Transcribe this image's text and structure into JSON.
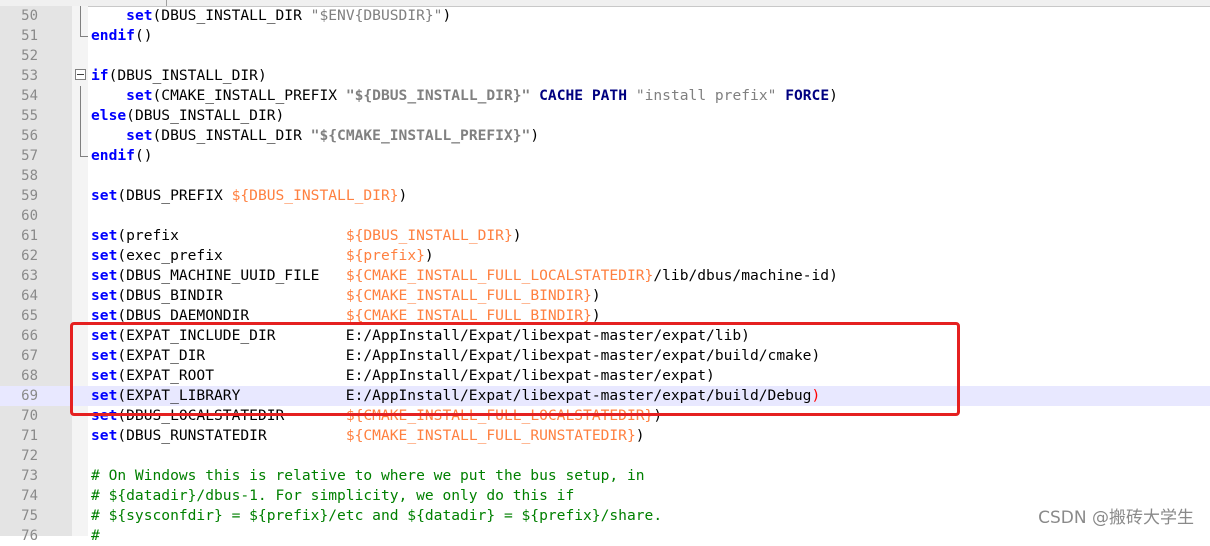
{
  "editor": {
    "lines": [
      {
        "n": "50",
        "fold": "vline",
        "indent": "    ",
        "parts": [
          [
            "kw",
            "set"
          ],
          [
            "",
            "(DBUS_INSTALL_DIR "
          ],
          [
            "str",
            "\"$ENV{DBUSDIR}\""
          ],
          [
            "",
            ")"
          ]
        ]
      },
      {
        "n": "51",
        "fold": "end",
        "indent": "",
        "parts": [
          [
            "kw",
            "endif"
          ],
          [
            "",
            "()"
          ]
        ]
      },
      {
        "n": "52",
        "fold": "",
        "indent": "",
        "parts": []
      },
      {
        "n": "53",
        "fold": "box",
        "indent": "",
        "parts": [
          [
            "kw",
            "if"
          ],
          [
            "",
            "(DBUS_INSTALL_DIR)"
          ]
        ]
      },
      {
        "n": "54",
        "fold": "vline",
        "indent": "    ",
        "parts": [
          [
            "kw",
            "set"
          ],
          [
            "",
            "(CMAKE_INSTALL_PREFIX "
          ],
          [
            "strv",
            "\"${DBUS_INSTALL_DIR}\""
          ],
          [
            "",
            " "
          ],
          [
            "kw2",
            "CACHE"
          ],
          [
            "",
            " "
          ],
          [
            "kw2",
            "PATH"
          ],
          [
            "",
            " "
          ],
          [
            "str",
            "\"install prefix\""
          ],
          [
            "",
            " "
          ],
          [
            "kw2",
            "FORCE"
          ],
          [
            "",
            ")"
          ]
        ]
      },
      {
        "n": "55",
        "fold": "vline",
        "indent": "",
        "parts": [
          [
            "kw",
            "else"
          ],
          [
            "",
            "(DBUS_INSTALL_DIR)"
          ]
        ]
      },
      {
        "n": "56",
        "fold": "vline",
        "indent": "    ",
        "parts": [
          [
            "kw",
            "set"
          ],
          [
            "",
            "(DBUS_INSTALL_DIR "
          ],
          [
            "strv",
            "\"${CMAKE_INSTALL_PREFIX}\""
          ],
          [
            "",
            ")"
          ]
        ]
      },
      {
        "n": "57",
        "fold": "end",
        "indent": "",
        "parts": [
          [
            "kw",
            "endif"
          ],
          [
            "",
            "()"
          ]
        ]
      },
      {
        "n": "58",
        "fold": "",
        "indent": "",
        "parts": []
      },
      {
        "n": "59",
        "fold": "",
        "indent": "",
        "parts": [
          [
            "kw",
            "set"
          ],
          [
            "",
            "(DBUS_PREFIX "
          ],
          [
            "var",
            "${DBUS_INSTALL_DIR}"
          ],
          [
            "",
            ")"
          ]
        ]
      },
      {
        "n": "60",
        "fold": "",
        "indent": "",
        "parts": []
      },
      {
        "n": "61",
        "fold": "",
        "indent": "",
        "parts": [
          [
            "kw",
            "set"
          ],
          [
            "",
            "(prefix                   "
          ],
          [
            "var",
            "${DBUS_INSTALL_DIR}"
          ],
          [
            "",
            ")"
          ]
        ]
      },
      {
        "n": "62",
        "fold": "",
        "indent": "",
        "parts": [
          [
            "kw",
            "set"
          ],
          [
            "",
            "(exec_prefix              "
          ],
          [
            "var",
            "${prefix}"
          ],
          [
            "",
            ")"
          ]
        ]
      },
      {
        "n": "63",
        "fold": "",
        "indent": "",
        "parts": [
          [
            "kw",
            "set"
          ],
          [
            "",
            "(DBUS_MACHINE_UUID_FILE   "
          ],
          [
            "var",
            "${CMAKE_INSTALL_FULL_LOCALSTATEDIR}"
          ],
          [
            "",
            "/lib/dbus/machine-id)"
          ]
        ]
      },
      {
        "n": "64",
        "fold": "",
        "indent": "",
        "parts": [
          [
            "kw",
            "set"
          ],
          [
            "",
            "(DBUS_BINDIR              "
          ],
          [
            "var",
            "${CMAKE_INSTALL_FULL_BINDIR}"
          ],
          [
            "",
            ")"
          ]
        ]
      },
      {
        "n": "65",
        "fold": "",
        "indent": "",
        "parts": [
          [
            "kw",
            "set"
          ],
          [
            "",
            "(DBUS_DAEMONDIR           "
          ],
          [
            "var",
            "${CMAKE_INSTALL_FULL_BINDIR}"
          ],
          [
            "",
            ")"
          ]
        ]
      },
      {
        "n": "66",
        "fold": "",
        "indent": "",
        "parts": [
          [
            "kw",
            "set"
          ],
          [
            "",
            "(EXPAT_INCLUDE_DIR        E:/AppInstall/Expat/libexpat-master/expat/lib)"
          ]
        ]
      },
      {
        "n": "67",
        "fold": "",
        "indent": "",
        "parts": [
          [
            "kw",
            "set"
          ],
          [
            "",
            "(EXPAT_DIR                E:/AppInstall/Expat/libexpat-master/expat/build/cmake)"
          ]
        ]
      },
      {
        "n": "68",
        "fold": "",
        "indent": "",
        "parts": [
          [
            "kw",
            "set"
          ],
          [
            "",
            "(EXPAT_ROOT               E:/AppInstall/Expat/libexpat-master/expat)"
          ]
        ]
      },
      {
        "n": "69",
        "fold": "",
        "indent": "",
        "current": true,
        "parts": [
          [
            "kw",
            "set"
          ],
          [
            "",
            "(EXPAT_LIBRARY            E:/AppInstall/Expat/libexpat-master/expat/build/Debug"
          ],
          [
            "redparen",
            ")"
          ]
        ]
      },
      {
        "n": "70",
        "fold": "",
        "indent": "",
        "parts": [
          [
            "kw",
            "set"
          ],
          [
            "",
            "(DBUS_LOCALSTATEDIR       "
          ],
          [
            "var",
            "${CMAKE_INSTALL_FULL_LOCALSTATEDIR}"
          ],
          [
            "",
            ")"
          ]
        ]
      },
      {
        "n": "71",
        "fold": "",
        "indent": "",
        "parts": [
          [
            "kw",
            "set"
          ],
          [
            "",
            "(DBUS_RUNSTATEDIR         "
          ],
          [
            "var",
            "${CMAKE_INSTALL_FULL_RUNSTATEDIR}"
          ],
          [
            "",
            ")"
          ]
        ]
      },
      {
        "n": "72",
        "fold": "",
        "indent": "",
        "parts": []
      },
      {
        "n": "73",
        "fold": "",
        "indent": "",
        "parts": [
          [
            "cmt",
            "# On Windows this is relative to where we put the bus setup, in"
          ]
        ]
      },
      {
        "n": "74",
        "fold": "",
        "indent": "",
        "parts": [
          [
            "cmt",
            "# ${datadir}/dbus-1. For simplicity, we only do this if"
          ]
        ]
      },
      {
        "n": "75",
        "fold": "",
        "indent": "",
        "parts": [
          [
            "cmt",
            "# ${sysconfdir} = ${prefix}/etc and ${datadir} = ${prefix}/share."
          ]
        ]
      },
      {
        "n": "76",
        "fold": "",
        "indent": "",
        "parts": [
          [
            "cmt",
            "#"
          ]
        ]
      }
    ]
  },
  "annotation": {
    "color": "#e52020",
    "covers_lines": [
      "66",
      "67",
      "68",
      "69"
    ]
  },
  "watermark": {
    "text": "CSDN @搬砖大学生"
  }
}
